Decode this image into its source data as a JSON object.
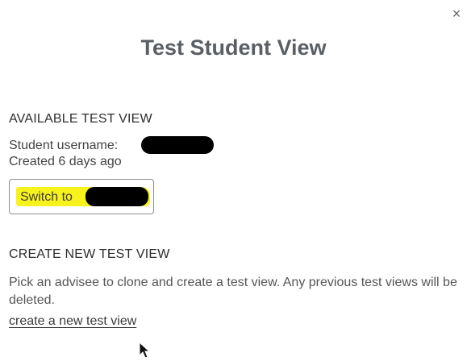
{
  "dialog": {
    "close_glyph": "×",
    "title": "Test Student View"
  },
  "available": {
    "heading": "AVAILABLE TEST VIEW",
    "username_label": "Student username:",
    "created": "Created 6 days ago",
    "switch_label": "Switch to",
    "highlight_color": "#f8f21c"
  },
  "create": {
    "heading": "CREATE NEW TEST VIEW",
    "description": "Pick an advisee to clone and create a test view. Any previous test views will be deleted.",
    "link_label": "create a new test view"
  }
}
